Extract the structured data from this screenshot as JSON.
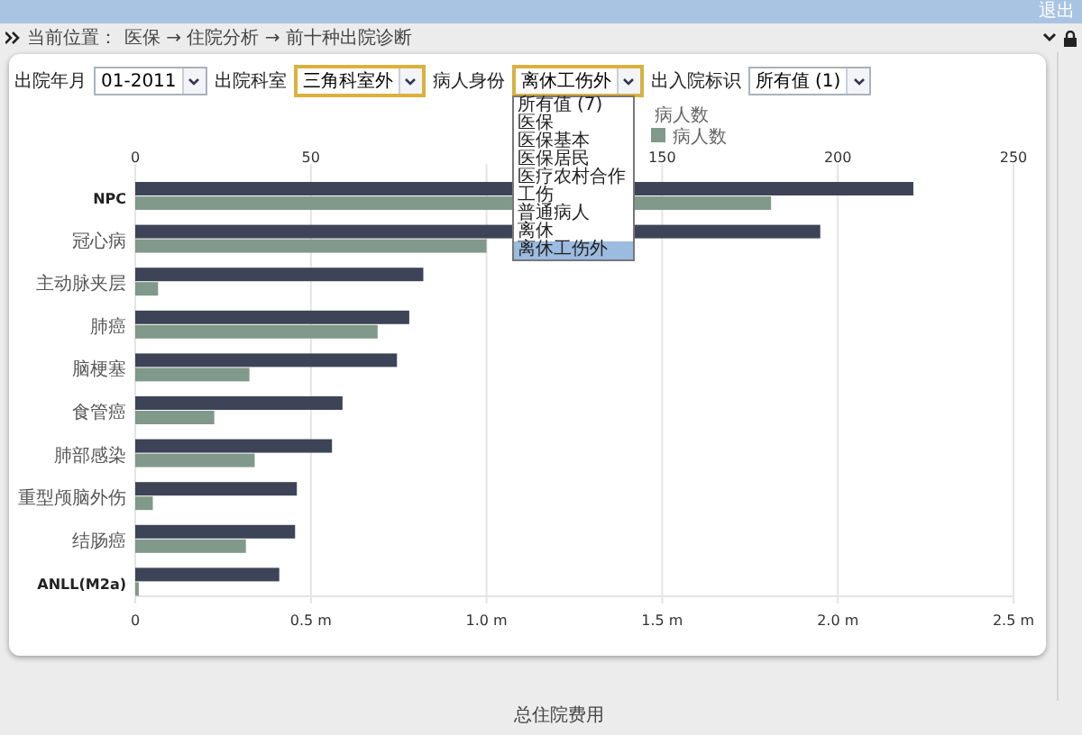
{
  "top_bar": {
    "logout": "退出"
  },
  "breadcrumb": {
    "label": "当前位置：",
    "path": "医保 → 住院分析 → 前十种出院诊断"
  },
  "filters": [
    {
      "label": "出院年月",
      "value": "01-2011",
      "highlighted": false
    },
    {
      "label": "出院科室",
      "value": "三角科室外",
      "highlighted": true
    },
    {
      "label": "病人身份",
      "value": "离休工伤外",
      "highlighted": true,
      "options": [
        {
          "label": "所有值 (7)",
          "selected": false
        },
        {
          "label": "医保",
          "selected": false
        },
        {
          "label": "医保基本",
          "selected": false
        },
        {
          "label": "医保居民",
          "selected": false
        },
        {
          "label": "医疗农村合作",
          "selected": false
        },
        {
          "label": "工伤",
          "selected": false
        },
        {
          "label": "普通病人",
          "selected": false
        },
        {
          "label": "离休",
          "selected": false
        },
        {
          "label": "离休工伤外",
          "selected": true
        }
      ]
    },
    {
      "label": "出入院标识",
      "value": "所有值 (1)",
      "highlighted": false
    }
  ],
  "chart_data": {
    "type": "bar",
    "orientation": "horizontal",
    "xlabel": "总住院费用",
    "grid": true,
    "legend_title": "病人数",
    "categories": [
      "NPC",
      "冠心病",
      "主动脉夹层",
      "肺癌",
      "脑梗塞",
      "食管癌",
      "肺部感染",
      "重型颅脑外伤",
      "结肠癌",
      "ANLL(M2a)"
    ],
    "series": [
      {
        "color": "#3d4457",
        "values": [
          2.215,
          1.95,
          0.82,
          0.78,
          0.745,
          0.59,
          0.56,
          0.46,
          0.455,
          0.41
        ]
      },
      {
        "name": "病人数",
        "color": "#80998a",
        "axis": "x2",
        "values": [
          181,
          100,
          6.5,
          69,
          32.5,
          22.5,
          34,
          5,
          31.5,
          1
        ]
      }
    ],
    "xlim": [
      0,
      2.5
    ],
    "xticks": [
      {
        "value": 0,
        "label": "0"
      },
      {
        "value": 0.5,
        "label": "0.5 m"
      },
      {
        "value": 1,
        "label": "1.0 m"
      },
      {
        "value": 1.5,
        "label": "1.5 m"
      },
      {
        "value": 2,
        "label": "2.0 m"
      },
      {
        "value": 2.5,
        "label": "2.5 m"
      }
    ],
    "x2lim": [
      0,
      250
    ],
    "x2ticks": [
      0,
      50,
      150,
      200,
      250
    ]
  }
}
